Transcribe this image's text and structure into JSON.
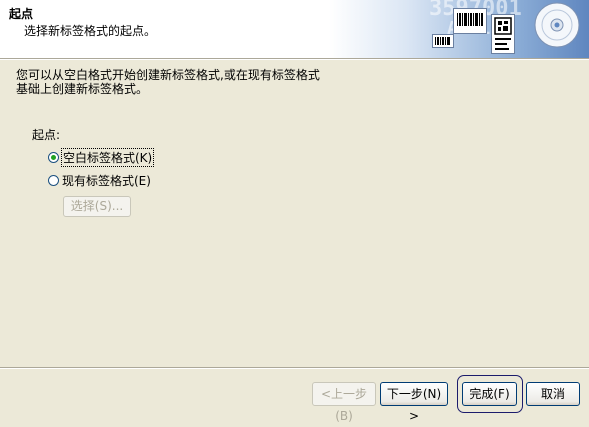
{
  "header": {
    "title": "起点",
    "subtitle": "选择新标签格式的起点。"
  },
  "description": [
    "您可以从空白格式开始创建新标签格式,或在现有标签格式",
    "基础上创建新标签格式。"
  ],
  "start": {
    "label": "起点:",
    "options": [
      {
        "label": "空白标签格式(K)",
        "selected": true
      },
      {
        "label": "现有标签格式(E)",
        "selected": false
      }
    ],
    "select_button": "选择(S)..."
  },
  "buttons": {
    "back": "<上一步(B)",
    "next": "下一步(N) >",
    "finish": "完成(F)",
    "cancel": "取消"
  },
  "colors": {
    "dialog_bg": "#ece9d8",
    "radio_dot": "#21a121",
    "button_border": "#003c74"
  }
}
